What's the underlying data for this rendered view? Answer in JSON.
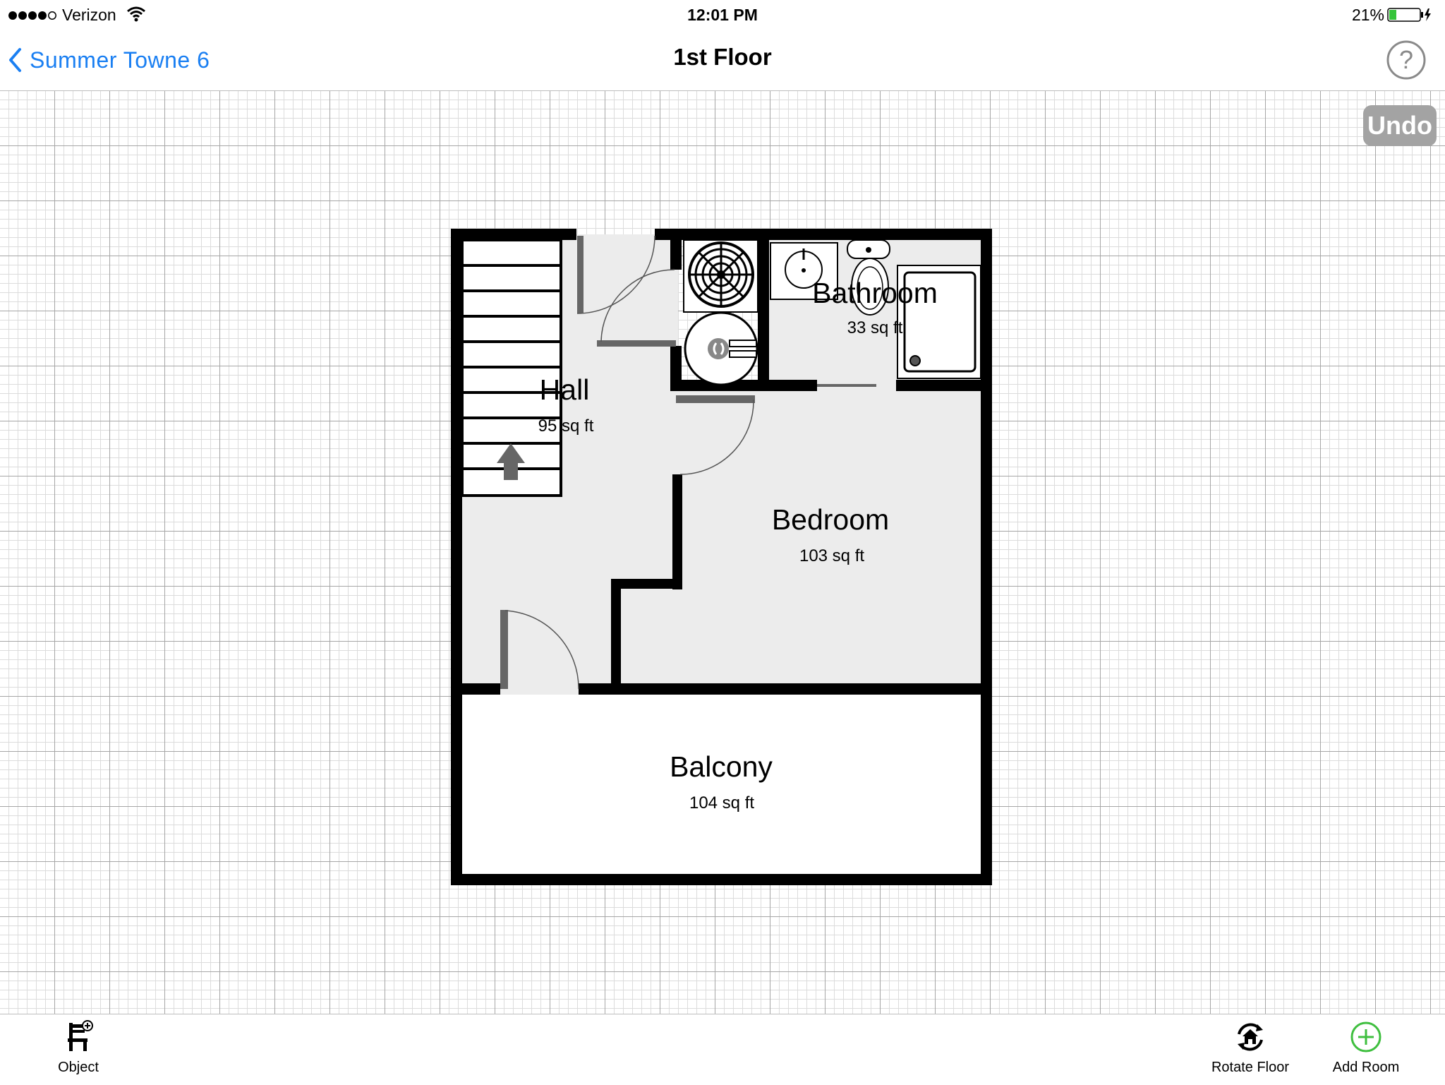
{
  "status_bar": {
    "carrier": "Verizon",
    "time": "12:01 PM",
    "battery": "21%",
    "signal_icon": "signal-bars-icon",
    "wifi_icon": "wifi-icon",
    "battery_icon": "battery-charging-icon"
  },
  "nav": {
    "back_label": "Summer Towne 6",
    "title": "1st Floor",
    "back_icon": "chevron-left-icon",
    "help_icon": "question-circle-icon",
    "accent_color": "#1a7ff2"
  },
  "canvas": {
    "undo_label": "Undo",
    "rooms": [
      {
        "name": "Hall",
        "area": "95 sq ft"
      },
      {
        "name": "Bathroom",
        "area": "33 sq ft"
      },
      {
        "name": "Bedroom",
        "area": "103 sq ft"
      },
      {
        "name": "Balcony",
        "area": "104 sq ft"
      }
    ]
  },
  "toolbar": {
    "object_label": "Object",
    "rotate_label": "Rotate Floor",
    "add_room_label": "Add Room",
    "add_room_color": "#3fbf3f"
  }
}
